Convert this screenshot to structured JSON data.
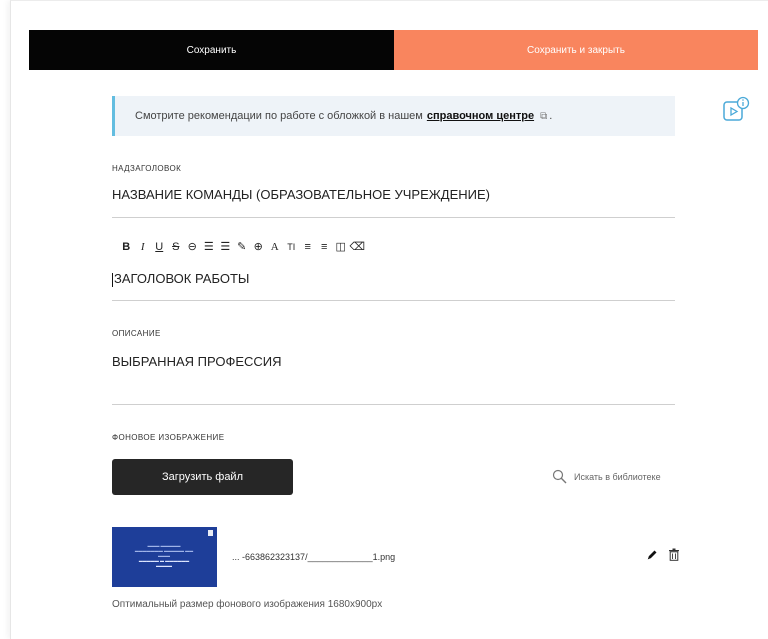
{
  "toolbar": {
    "save_label": "Сохранить",
    "save_close_label": "Сохранить и закрыть",
    "colors": {
      "save": "#050505",
      "save_close": "#f9855e"
    }
  },
  "info": {
    "text": "Смотрите рекомендации по работе с обложкой в нашем",
    "link": "справочном центре",
    "suffix": ".",
    "icon": "external-link-icon",
    "accent": "#63bde0"
  },
  "overtitle": {
    "label": "НАДЗАГОЛОВОК",
    "value": "НАЗВАНИЕ КОМАНДЫ (ОБРАЗОВАТЕЛЬНОЕ УЧРЕЖДЕНИЕ)"
  },
  "editor": {
    "tools": [
      {
        "name": "bold",
        "glyph": "B"
      },
      {
        "name": "italic",
        "glyph": "I"
      },
      {
        "name": "underline",
        "glyph": "U"
      },
      {
        "name": "strikethrough",
        "glyph": "S"
      },
      {
        "name": "link",
        "glyph": "⊖"
      },
      {
        "name": "ordered-list",
        "glyph": "☰"
      },
      {
        "name": "bullet-list",
        "glyph": "☰"
      },
      {
        "name": "pen",
        "glyph": "✎"
      },
      {
        "name": "circle-mark",
        "glyph": "⊕"
      },
      {
        "name": "font",
        "glyph": "A"
      },
      {
        "name": "text-size",
        "glyph": "TI"
      },
      {
        "name": "line-height",
        "glyph": "≡"
      },
      {
        "name": "align",
        "glyph": "≡"
      },
      {
        "name": "book",
        "glyph": "◫"
      },
      {
        "name": "clear-format",
        "glyph": "⌫"
      }
    ],
    "value": "ЗАГОЛОВОК РАБОТЫ"
  },
  "description": {
    "label": "ОПИСАНИЕ",
    "value": "ВЫБРАННАЯ ПРОФЕССИЯ"
  },
  "background": {
    "label": "ФОНОВОЕ ИЗОБРАЖЕНИЕ",
    "upload_label": "Загрузить файл",
    "library_label": "Искать в библиотеке",
    "file_name": "... -663862323137/_____________1.png",
    "hint": "Оптимальный размер фонового изображения 1680x900px",
    "thumb_color": "#1e3e99"
  }
}
